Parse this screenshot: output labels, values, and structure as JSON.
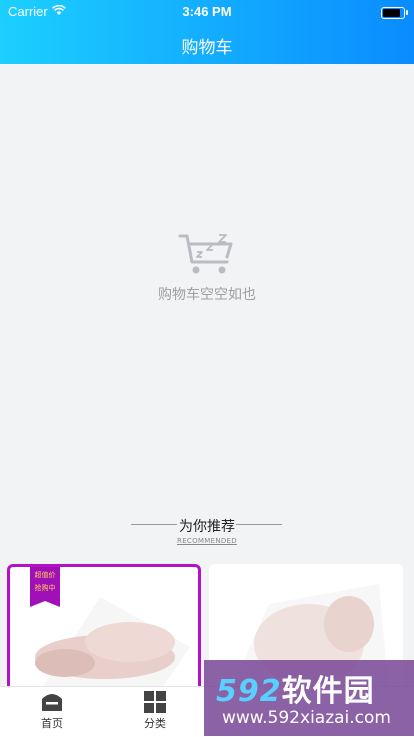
{
  "status": {
    "carrier": "Carrier",
    "time": "3:46 PM"
  },
  "header": {
    "title": "购物车"
  },
  "empty_state": {
    "icon": "empty-cart-sleeping-icon",
    "message": "购物车空空如也"
  },
  "recommend": {
    "title": "为你推荐",
    "subtitle": "RECOMMENDED"
  },
  "products": [
    {
      "image": "duck-product",
      "badge": [
        "超值价",
        "抢购中"
      ]
    },
    {
      "image": "duck-product",
      "badge": []
    }
  ],
  "tabs": [
    {
      "label": "首页",
      "icon": "home-icon"
    },
    {
      "label": "分类",
      "icon": "grid-icon"
    }
  ],
  "watermark": {
    "brand_num": "592",
    "brand_text": "软件园",
    "url": "www.592xiazai.com"
  },
  "colors": {
    "header_start": "#1ccfff",
    "header_end": "#0a8cff",
    "badge": "#a00fb7",
    "bg": "#f2f3f5"
  }
}
